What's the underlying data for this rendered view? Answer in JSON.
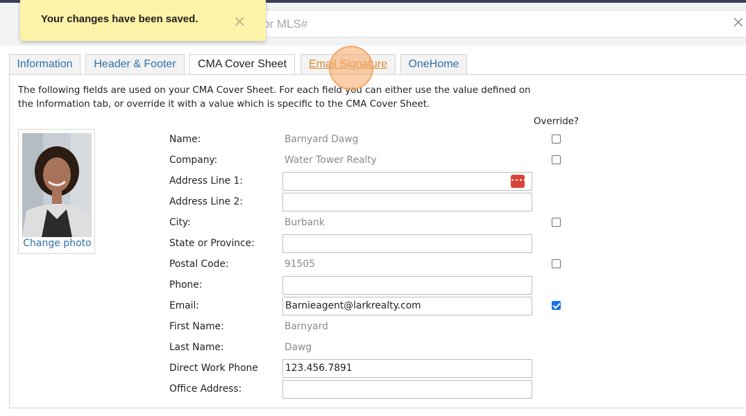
{
  "search": {
    "placeholder": "or MLS#",
    "clear_icon": "×"
  },
  "toast": {
    "message": "Your changes have been saved.",
    "close_icon": "×"
  },
  "tabs": [
    {
      "label": "Information",
      "active": false
    },
    {
      "label": "Header & Footer",
      "active": false
    },
    {
      "label": "CMA Cover Sheet",
      "active": true
    },
    {
      "label": "Email Signature",
      "active": false,
      "hover": true
    },
    {
      "label": "OneHome",
      "active": false
    }
  ],
  "intro": "The following fields are used on your CMA Cover Sheet. For each field you can either use the value defined on the Information tab, or override it with a value which is specific to the CMA Cover Sheet.",
  "override_header": "Override?",
  "photo": {
    "change_label": "Change photo"
  },
  "fields": [
    {
      "label": "Name:",
      "value": "Barnyard Dawg",
      "kind": "static",
      "override": false
    },
    {
      "label": "Company:",
      "value": "Water Tower Realty",
      "kind": "static",
      "override": false
    },
    {
      "label": "Address Line 1:",
      "value": "",
      "kind": "input",
      "badge": "••••"
    },
    {
      "label": "Address Line 2:",
      "value": "",
      "kind": "input"
    },
    {
      "label": "City:",
      "value": "Burbank",
      "kind": "static",
      "override": false
    },
    {
      "label": "State or Province:",
      "value": "",
      "kind": "input"
    },
    {
      "label": "Postal Code:",
      "value": "91505",
      "kind": "static",
      "override": false
    },
    {
      "label": "Phone:",
      "value": "",
      "kind": "input"
    },
    {
      "label": "Email:",
      "value": "Barnieagent@larkrealty.com",
      "kind": "input",
      "override": true
    },
    {
      "label": "First Name:",
      "value": "Barnyard",
      "kind": "static"
    },
    {
      "label": "Last Name:",
      "value": "Dawg",
      "kind": "static"
    },
    {
      "label": "Direct Work Phone",
      "value": "123.456.7891",
      "kind": "input"
    },
    {
      "label": "Office Address:",
      "value": "",
      "kind": "input"
    }
  ],
  "colors": {
    "link": "#2f6fa8",
    "toast_bg": "#fdf3a8",
    "hover_tab": "#d98a2b",
    "checkbox_checked": "#1a73e8"
  }
}
